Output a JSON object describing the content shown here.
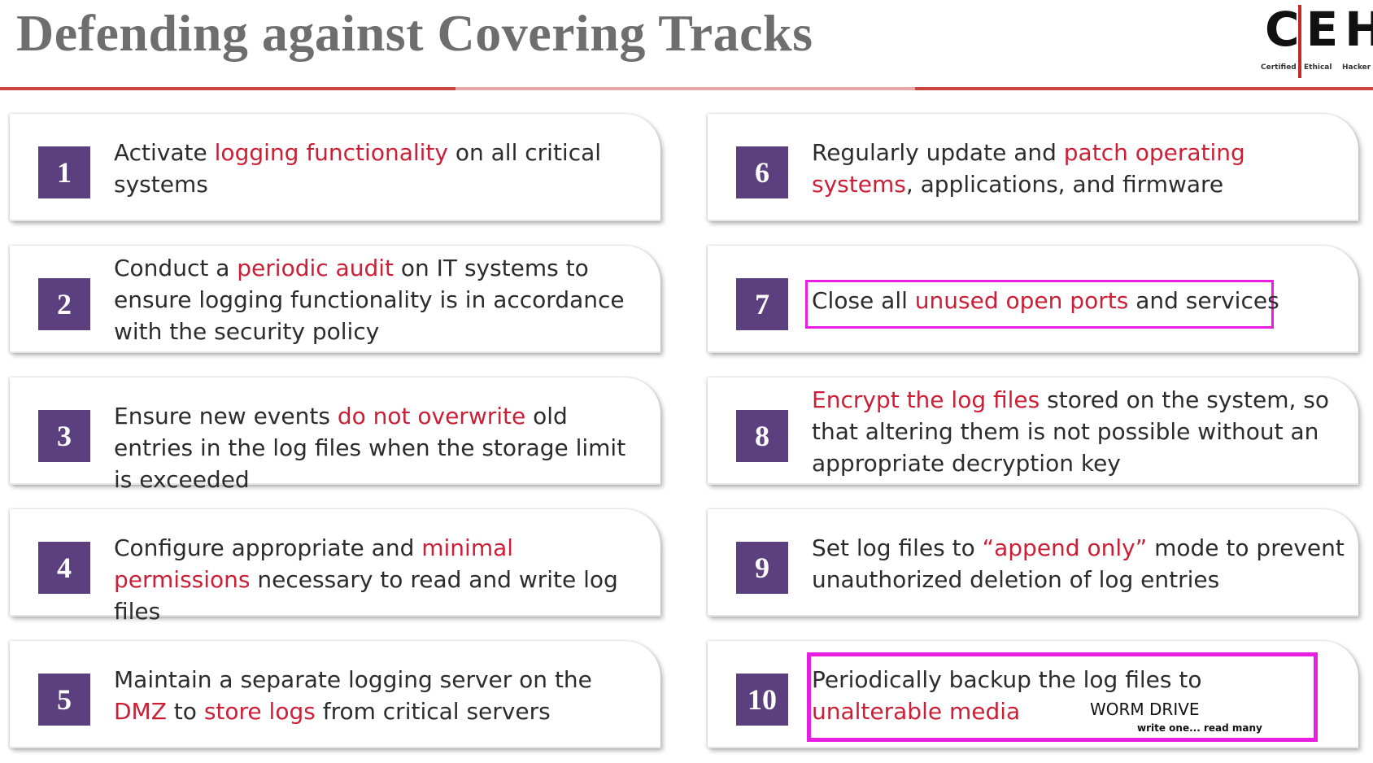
{
  "title": "Defending against Covering Tracks",
  "logo": {
    "letters": "CEH",
    "sub": [
      "Certified",
      "Ethical",
      "Hacker"
    ]
  },
  "colors": {
    "accent": "#5b3f7e",
    "highlight": "#cc1f36",
    "box": "#e81ee0"
  },
  "items": [
    {
      "num": "1",
      "pre": "Activate ",
      "hl": "logging functionality",
      "post": " on all critical systems"
    },
    {
      "num": "2",
      "pre": "Conduct a ",
      "hl": "periodic audit",
      "post": " on IT systems to ensure logging functionality is in accordance with the security policy"
    },
    {
      "num": "3",
      "pre": "Ensure new events ",
      "hl": "do not overwrite",
      "post": " old entries in the log files when the storage limit is exceeded"
    },
    {
      "num": "4",
      "pre": "Configure appropriate and ",
      "hl": "minimal permissions",
      "post": " necessary to read and write log files"
    },
    {
      "num": "5",
      "pre": "Maintain a separate logging server on the ",
      "hl": "DMZ",
      "post": " to ",
      "hl2": "store logs",
      "post2": " from critical servers"
    },
    {
      "num": "6",
      "pre": "Regularly update and ",
      "hl": "patch operating systems",
      "post": ", applications, and firmware"
    },
    {
      "num": "7",
      "pre": "Close all ",
      "hl": "unused open ports",
      "post": " and services"
    },
    {
      "num": "8",
      "pre": "",
      "hl": "Encrypt the log files",
      "post": " stored on the system, so that altering them is not possible without an appropriate decryption key"
    },
    {
      "num": "9",
      "pre": "Set log files to ",
      "hl": "“append only”",
      "post": " mode to prevent unauthorized deletion of log entries"
    },
    {
      "num": "10",
      "pre": "Periodically backup the log files to ",
      "hl": "unalterable media",
      "post": ""
    }
  ],
  "annotations": {
    "worm": "WORM DRIVE",
    "worm_sub": "write one... read many"
  }
}
